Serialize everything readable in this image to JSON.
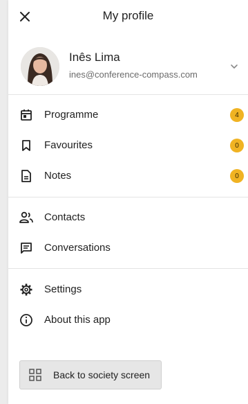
{
  "header": {
    "title": "My profile",
    "close_icon": "close-icon"
  },
  "profile": {
    "name": "Inês Lima",
    "email": "ines@conference-compass.com",
    "expand_icon": "chevron-down-icon"
  },
  "menu": {
    "section1": [
      {
        "label": "Programme",
        "icon": "calendar-icon",
        "badge": "4"
      },
      {
        "label": "Favourites",
        "icon": "bookmark-icon",
        "badge": "0"
      },
      {
        "label": "Notes",
        "icon": "note-icon",
        "badge": "0"
      }
    ],
    "section2": [
      {
        "label": "Contacts",
        "icon": "contacts-icon"
      },
      {
        "label": "Conversations",
        "icon": "chat-icon"
      }
    ],
    "section3": [
      {
        "label": "Settings",
        "icon": "gear-icon"
      },
      {
        "label": "About this app",
        "icon": "info-icon"
      }
    ]
  },
  "footer": {
    "back_label": "Back to society screen",
    "back_icon": "grid-icon"
  },
  "colors": {
    "badge": "#f0b323",
    "background": "#ececec",
    "panel": "#ffffff"
  }
}
